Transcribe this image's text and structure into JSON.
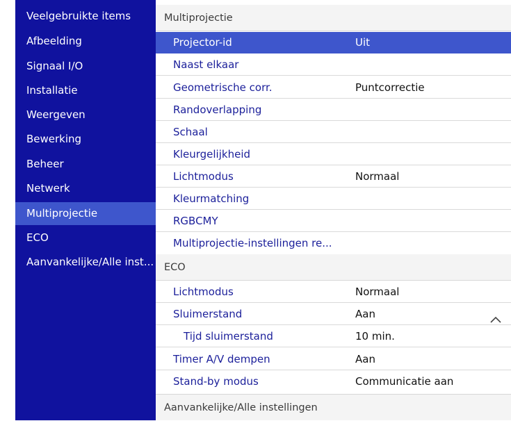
{
  "sidebar": {
    "items": [
      {
        "label": "Veelgebruikte items"
      },
      {
        "label": "Afbeelding"
      },
      {
        "label": "Signaal I/O"
      },
      {
        "label": "Installatie"
      },
      {
        "label": "Weergeven"
      },
      {
        "label": "Bewerking"
      },
      {
        "label": "Beheer"
      },
      {
        "label": "Netwerk"
      },
      {
        "label": "Multiprojectie"
      },
      {
        "label": "ECO"
      },
      {
        "label": "Aanvankelijke/Alle inst..."
      }
    ],
    "selected_index": 8
  },
  "content": {
    "multi_header": "Multiprojectie",
    "multi_rows": [
      {
        "label": "Projector-id",
        "value": "Uit"
      },
      {
        "label": "Naast elkaar",
        "value": ""
      },
      {
        "label": "Geometrische corr.",
        "value": "Puntcorrectie"
      },
      {
        "label": "Randoverlapping",
        "value": ""
      },
      {
        "label": "Schaal",
        "value": ""
      },
      {
        "label": "Kleurgelijkheid",
        "value": ""
      },
      {
        "label": "Lichtmodus",
        "value": "Normaal"
      },
      {
        "label": "Kleurmatching",
        "value": ""
      },
      {
        "label": "RGBCMY",
        "value": ""
      },
      {
        "label": "Multiprojectie-instellingen re...",
        "value": ""
      }
    ],
    "eco_header": "ECO",
    "eco_rows": [
      {
        "label": "Lichtmodus",
        "value": "Normaal"
      },
      {
        "label": "Sluimerstand",
        "value": "Aan"
      },
      {
        "label": "Tijd sluimerstand",
        "value": "10 min."
      },
      {
        "label": "Timer A/V dempen",
        "value": "Aan"
      },
      {
        "label": "Stand-by modus",
        "value": "Communicatie aan"
      }
    ],
    "footer_header": "Aanvankelijke/Alle instellingen",
    "scroll_icon": "chevron-up-icon"
  },
  "colors": {
    "sidebar_bg": "#10129e",
    "selection": "#3e56cc",
    "label_text": "#1b1f9a",
    "header_bg": "#f4f4f4"
  }
}
